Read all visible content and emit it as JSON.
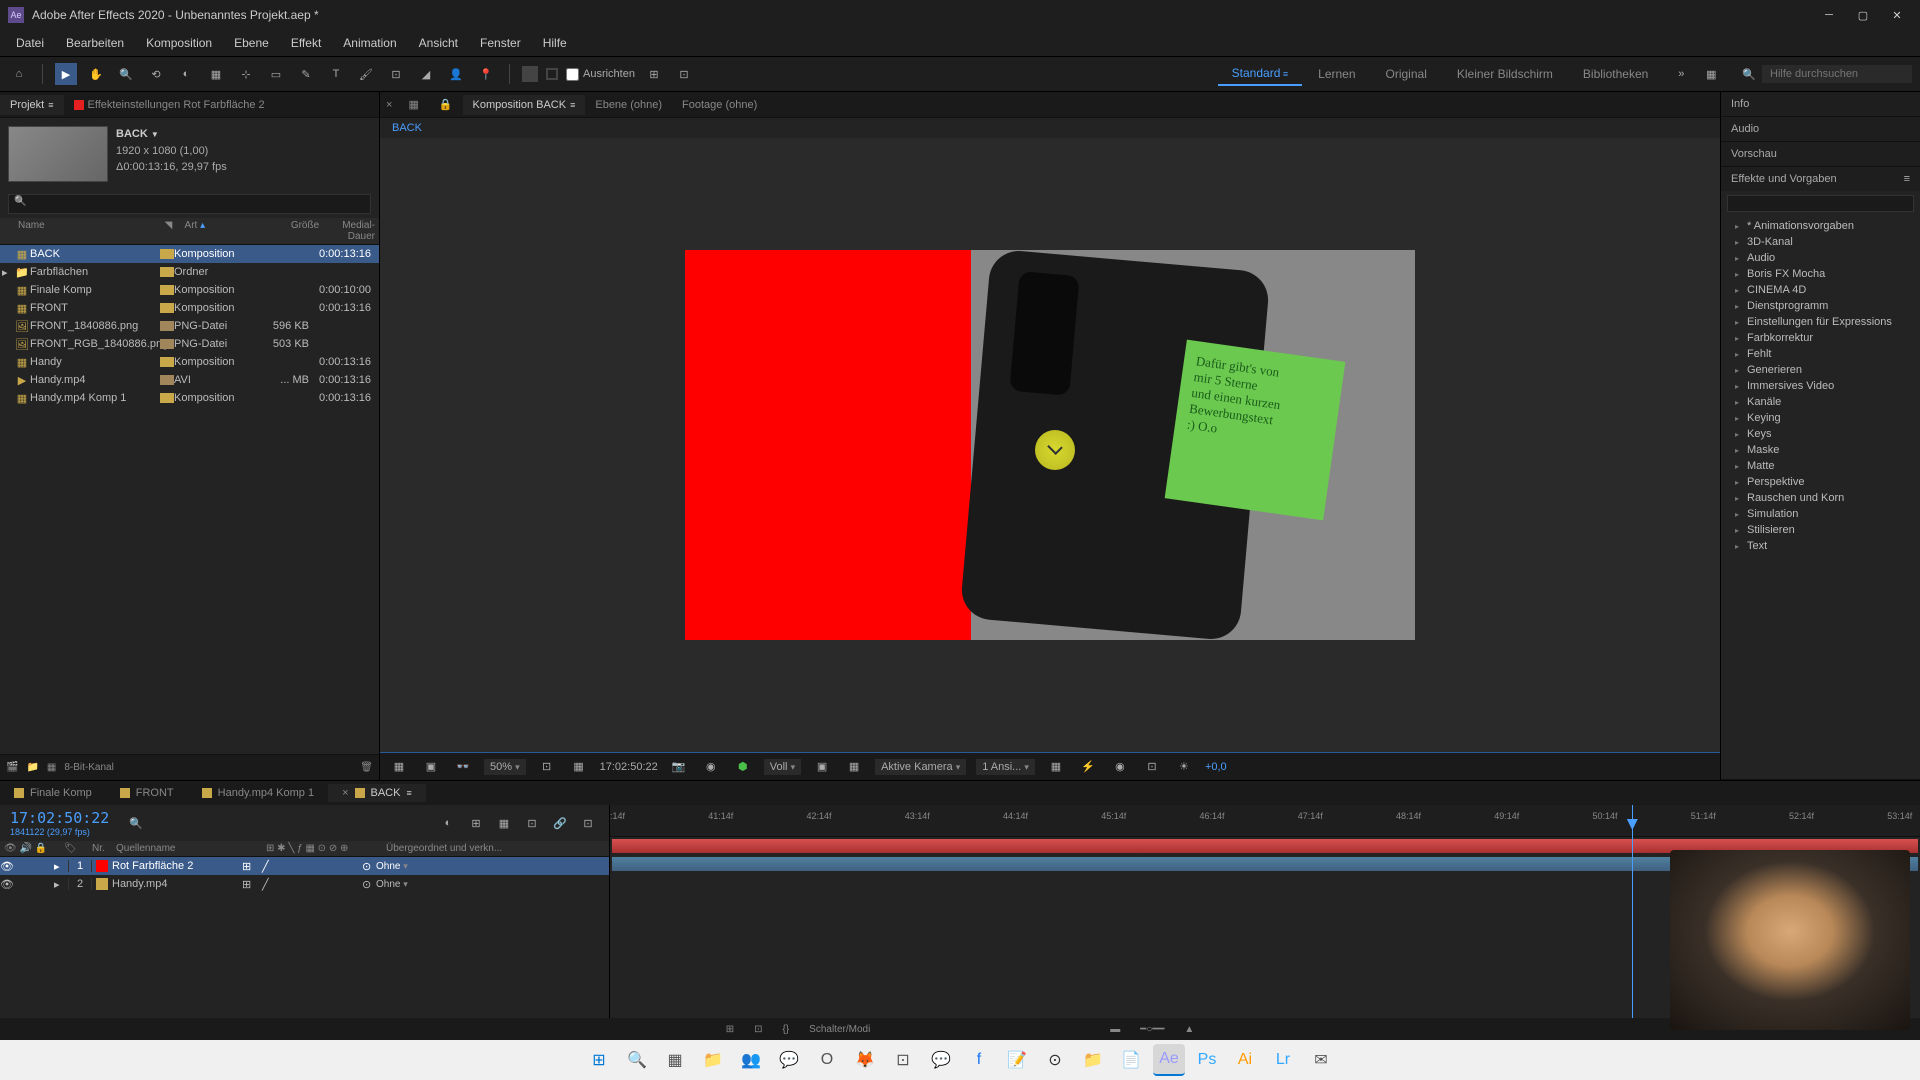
{
  "app": {
    "title": "Adobe After Effects 2020 - Unbenanntes Projekt.aep *",
    "logo": "Ae"
  },
  "menu": [
    "Datei",
    "Bearbeiten",
    "Komposition",
    "Ebene",
    "Effekt",
    "Animation",
    "Ansicht",
    "Fenster",
    "Hilfe"
  ],
  "toolbar": {
    "align_label": "Ausrichten",
    "search_placeholder": "Hilfe durchsuchen"
  },
  "workspaces": {
    "items": [
      "Standard",
      "Lernen",
      "Original",
      "Kleiner Bildschirm",
      "Bibliotheken"
    ],
    "active": 0
  },
  "project_panel": {
    "tab_project": "Projekt",
    "tab_effect": "Effekteinstellungen Rot Farbfläche 2",
    "name": "BACK",
    "res": "1920 x 1080 (1,00)",
    "dur": "Δ0:00:13:16, 29,97 fps",
    "headers": {
      "name": "Name",
      "art": "Art",
      "size": "Größe",
      "dur": "Medial-Dauer"
    },
    "items": [
      {
        "name": "BACK",
        "art": "Komposition",
        "size": "",
        "dur": "0:00:13:16",
        "icon": "comp",
        "selected": true
      },
      {
        "name": "Farbflächen",
        "art": "Ordner",
        "size": "",
        "dur": "",
        "icon": "folder"
      },
      {
        "name": "Finale Komp",
        "art": "Komposition",
        "size": "",
        "dur": "0:00:10:00",
        "icon": "comp"
      },
      {
        "name": "FRONT",
        "art": "Komposition",
        "size": "",
        "dur": "0:00:13:16",
        "icon": "comp"
      },
      {
        "name": "FRONT_1840886.png",
        "art": "PNG-Datei",
        "size": "596 KB",
        "dur": "",
        "icon": "png"
      },
      {
        "name": "FRONT_RGB_1840886.png",
        "art": "PNG-Datei",
        "size": "503 KB",
        "dur": "",
        "icon": "png"
      },
      {
        "name": "Handy",
        "art": "Komposition",
        "size": "",
        "dur": "0:00:13:16",
        "icon": "comp"
      },
      {
        "name": "Handy.mp4",
        "art": "AVI",
        "size": "... MB",
        "dur": "0:00:13:16",
        "icon": "avi"
      },
      {
        "name": "Handy.mp4 Komp 1",
        "art": "Komposition",
        "size": "",
        "dur": "0:00:13:16",
        "icon": "comp"
      }
    ],
    "footer_bpc": "8-Bit-Kanal"
  },
  "composition": {
    "tabs": [
      {
        "label": "Komposition BACK",
        "active": true
      },
      {
        "label": "Ebene (ohne)"
      },
      {
        "label": "Footage (ohne)"
      }
    ],
    "breadcrumb": "BACK",
    "note_text": "Dafür gibt's von\nmir 5 Sterne\nund einen kurzen\nBewerbungstext\n:) O.o",
    "footer": {
      "zoom": "50%",
      "timecode": "17:02:50:22",
      "res": "Voll",
      "camera": "Aktive Kamera",
      "views": "1 Ansi...",
      "exposure": "+0,0"
    }
  },
  "right": {
    "sections": [
      "Info",
      "Audio",
      "Vorschau",
      "Effekte und Vorgaben"
    ],
    "presets": [
      "* Animationsvorgaben",
      "3D-Kanal",
      "Audio",
      "Boris FX Mocha",
      "CINEMA 4D",
      "Dienstprogramm",
      "Einstellungen für Expressions",
      "Farbkorrektur",
      "Fehlt",
      "Generieren",
      "Immersives Video",
      "Kanäle",
      "Keying",
      "Keys",
      "Maske",
      "Matte",
      "Perspektive",
      "Rauschen und Korn",
      "Simulation",
      "Stilisieren",
      "Text"
    ]
  },
  "timeline": {
    "tabs": [
      {
        "label": "Finale Komp"
      },
      {
        "label": "FRONT"
      },
      {
        "label": "Handy.mp4 Komp 1"
      },
      {
        "label": "BACK",
        "active": true
      }
    ],
    "timecode": "17:02:50:22",
    "frames": "1841122 (29,97 fps)",
    "col_num": "Nr.",
    "col_name": "Quellenname",
    "col_parent": "Übergeordnet und verkn...",
    "parent_none": "Ohne",
    "ruler": [
      ":14f",
      "41:14f",
      "42:14f",
      "43:14f",
      "44:14f",
      "45:14f",
      "46:14f",
      "47:14f",
      "48:14f",
      "49:14f",
      "50:14f",
      "51:14f",
      "52:14f",
      "53:14f"
    ],
    "layers": [
      {
        "num": "1",
        "name": "Rot Farbfläche 2",
        "color": "#ff0000",
        "selected": true,
        "parent": "Ohne"
      },
      {
        "num": "2",
        "name": "Handy.mp4",
        "color": "#c9a849",
        "selected": false,
        "parent": "Ohne"
      }
    ],
    "footer": "Schalter/Modi"
  },
  "taskbar": {
    "icons": [
      "windows",
      "search",
      "taskview",
      "explorer",
      "teams",
      "whatsapp",
      "opera",
      "firefox",
      "app1",
      "messenger",
      "facebook",
      "notes",
      "obs",
      "folder",
      "text",
      "ae",
      "ps",
      "ai",
      "lr",
      "mail"
    ]
  }
}
